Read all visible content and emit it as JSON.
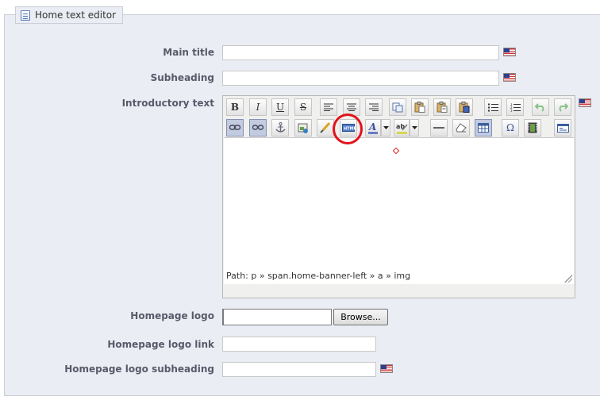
{
  "panel": {
    "legend": "Home text editor",
    "legend_icon": "document-icon"
  },
  "form": {
    "main_title": {
      "label": "Main title",
      "value": ""
    },
    "subheading": {
      "label": "Subheading",
      "value": ""
    },
    "intro": {
      "label": "Introductory text"
    },
    "logo": {
      "label": "Homepage logo",
      "value": "",
      "browse_label": "Browse..."
    },
    "logo_link": {
      "label": "Homepage logo link",
      "value": ""
    },
    "logo_subheading": {
      "label": "Homepage logo subheading",
      "value": ""
    }
  },
  "language_flag": "us-flag-icon",
  "editor": {
    "path_label": "Path: p » span.home-banner-left » a » img",
    "toolbar_row1": [
      "bold",
      "italic",
      "underline",
      "strikethrough",
      "align-left",
      "align-center",
      "align-right",
      "copy",
      "paste",
      "paste-text",
      "paste-word",
      "bullet-list",
      "numbered-list",
      "undo",
      "redo"
    ],
    "toolbar_row2": [
      "link",
      "unlink",
      "anchor",
      "image",
      "cleanup",
      "html-source",
      "font-color",
      "highlight-color",
      "horizontal-rule",
      "remove-format",
      "table",
      "special-char",
      "media",
      "fullscreen"
    ],
    "glyphs": {
      "bold": "B",
      "italic": "I",
      "underline": "U",
      "strike": "S",
      "omega": "Ω"
    }
  },
  "annotation": {
    "color": "#e3121a"
  }
}
